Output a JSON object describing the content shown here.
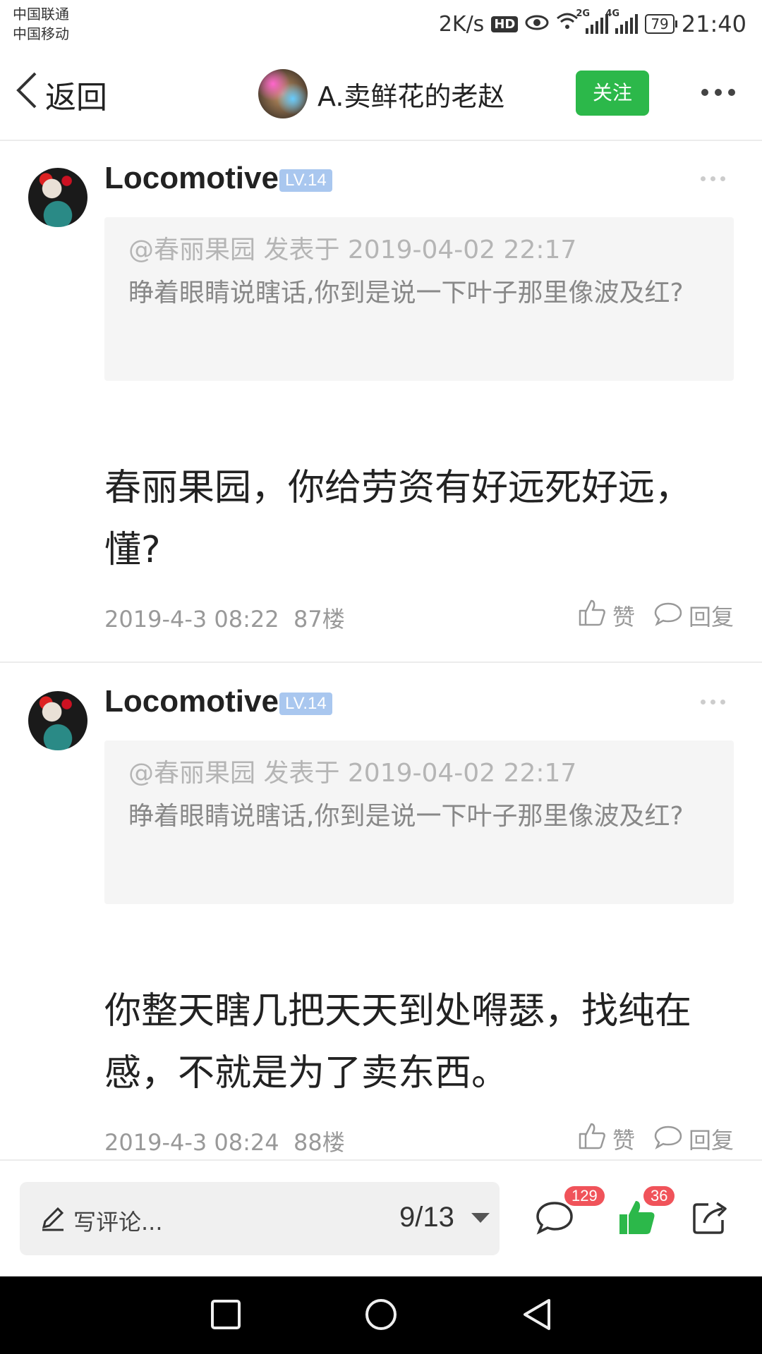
{
  "status_bar": {
    "carrier1": "中国联通",
    "carrier2": "中国移动",
    "speed": "2K/s",
    "hd": "HD",
    "net1": "2G",
    "net2": "4G",
    "battery": "79",
    "time": "21:40"
  },
  "nav": {
    "back_label": "返回",
    "title": "A.卖鲜花的老赵",
    "follow_label": "关注"
  },
  "comments": [
    {
      "user": "Locomotive",
      "level": "LV.14",
      "quote_meta": "@春丽果园 发表于 2019-04-02 22:17",
      "quote_text": "睁着眼睛说瞎话,你到是说一下叶子那里像波及红?",
      "body": "春丽果园，你给劳资有好远死好远，懂?",
      "time": "2019-4-3 08:22",
      "floor": "87楼",
      "like_label": "赞",
      "reply_label": "回复"
    },
    {
      "user": "Locomotive",
      "level": "LV.14",
      "quote_meta": "@春丽果园 发表于 2019-04-02 22:17",
      "quote_text": "睁着眼睛说瞎话,你到是说一下叶子那里像波及红?",
      "body": "你整天瞎几把天天到处嘚瑟，找纯在感，不就是为了卖东西。",
      "time": "2019-4-3 08:24",
      "floor": "88楼",
      "like_label": "赞",
      "reply_label": "回复"
    }
  ],
  "bottom_bar": {
    "write_placeholder": "写评论...",
    "page_indicator": "9/13",
    "comment_count": "129",
    "like_count": "36",
    "accent_color": "#2cb84a"
  }
}
